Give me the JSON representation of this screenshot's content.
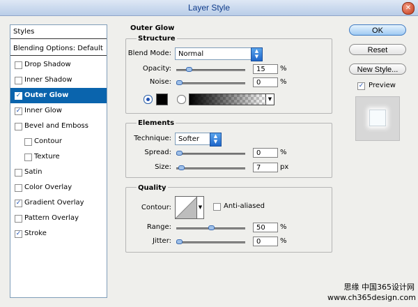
{
  "window": {
    "title": "Layer Style",
    "close_glyph": "✕"
  },
  "style_list": {
    "styles_header": "Styles",
    "blending_header": "Blending Options: Default",
    "items": [
      {
        "label": "Drop Shadow",
        "checked": false,
        "active": false,
        "sub": false
      },
      {
        "label": "Inner Shadow",
        "checked": false,
        "active": false,
        "sub": false
      },
      {
        "label": "Outer Glow",
        "checked": true,
        "active": true,
        "sub": false
      },
      {
        "label": "Inner Glow",
        "checked": true,
        "active": false,
        "sub": false
      },
      {
        "label": "Bevel and Emboss",
        "checked": false,
        "active": false,
        "sub": false
      },
      {
        "label": "Contour",
        "checked": false,
        "active": false,
        "sub": true
      },
      {
        "label": "Texture",
        "checked": false,
        "active": false,
        "sub": true
      },
      {
        "label": "Satin",
        "checked": false,
        "active": false,
        "sub": false
      },
      {
        "label": "Color Overlay",
        "checked": false,
        "active": false,
        "sub": false
      },
      {
        "label": "Gradient Overlay",
        "checked": true,
        "active": false,
        "sub": false
      },
      {
        "label": "Pattern Overlay",
        "checked": false,
        "active": false,
        "sub": false
      },
      {
        "label": "Stroke",
        "checked": true,
        "active": false,
        "sub": false
      }
    ]
  },
  "panel": {
    "title": "Outer Glow",
    "structure": {
      "title": "Structure",
      "blend_mode_label": "Blend Mode:",
      "blend_mode_value": "Normal",
      "opacity_label": "Opacity:",
      "opacity_value": "15",
      "opacity_unit": "%",
      "opacity_level": 0.15,
      "noise_label": "Noise:",
      "noise_value": "0",
      "noise_unit": "%",
      "noise_level": 0,
      "glow_color": "#000000",
      "color_radio_selected": true,
      "gradient_radio_selected": false
    },
    "elements": {
      "title": "Elements",
      "technique_label": "Technique:",
      "technique_value": "Softer",
      "spread_label": "Spread:",
      "spread_value": "0",
      "spread_unit": "%",
      "spread_level": 0,
      "size_label": "Size:",
      "size_value": "7",
      "size_unit": "px",
      "size_level": 0.03
    },
    "quality": {
      "title": "Quality",
      "contour_label": "Contour:",
      "anti_aliased_label": "Anti-aliased",
      "anti_aliased_checked": false,
      "range_label": "Range:",
      "range_value": "50",
      "range_unit": "%",
      "range_level": 0.5,
      "jitter_label": "Jitter:",
      "jitter_value": "0",
      "jitter_unit": "%",
      "jitter_level": 0
    }
  },
  "buttons": {
    "ok": "OK",
    "reset": "Reset",
    "new_style": "New Style...",
    "preview_label": "Preview",
    "preview_checked": true
  },
  "watermark": {
    "line1": "思缘 中国365设计网",
    "line2": "www.ch365design.com"
  },
  "colors": {
    "accent": "#0a64ad",
    "title_text": "#0d3a8a"
  }
}
